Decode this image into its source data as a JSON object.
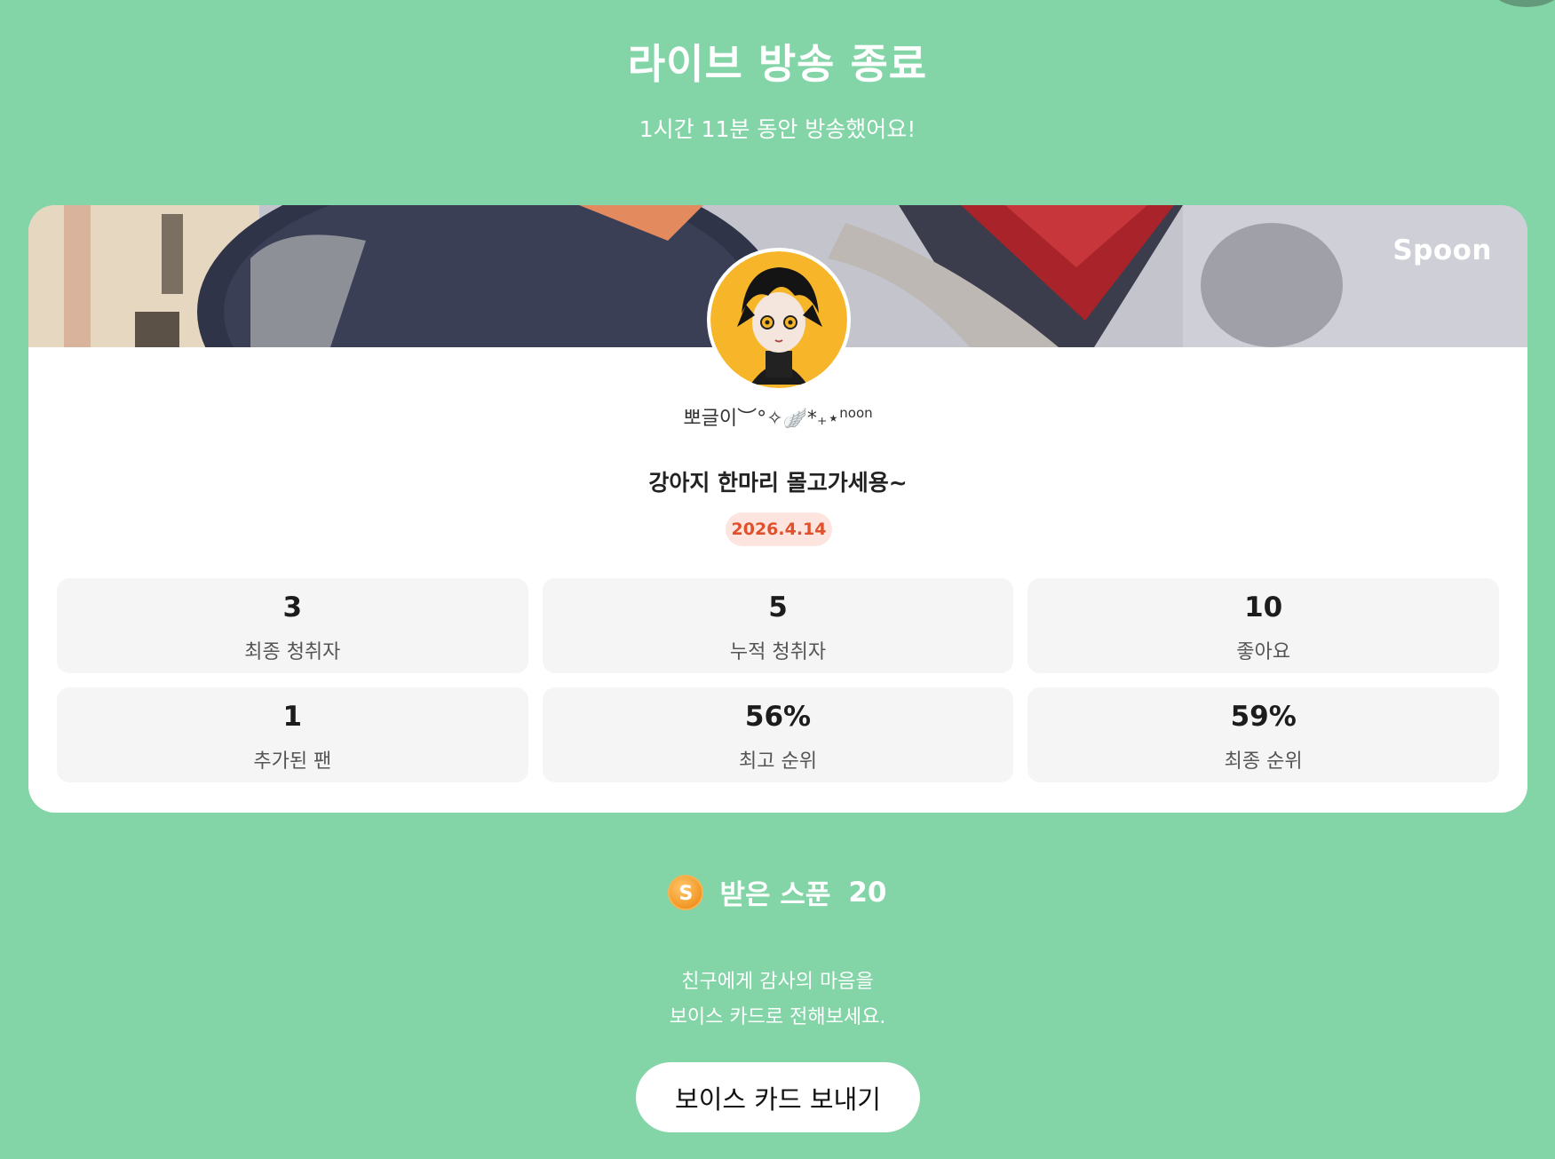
{
  "header": {
    "title": "라이브 방송 종료",
    "subtitle": "1시간 11분 동안 방송했어요!"
  },
  "card": {
    "brand": "Spoon",
    "nickname": "뽀글이︶°✧🪽*₊⋆",
    "nickname_suffix": "noon",
    "live_title": "강아지 한마리 몰고가세용~",
    "date": "2026.4.14",
    "stats": [
      {
        "value": "3",
        "label": "최종 청취자"
      },
      {
        "value": "5",
        "label": "누적 청취자"
      },
      {
        "value": "10",
        "label": "좋아요"
      },
      {
        "value": "1",
        "label": "추가된 팬"
      },
      {
        "value": "56%",
        "label": "최고 순위"
      },
      {
        "value": "59%",
        "label": "최종 순위"
      }
    ]
  },
  "spoons": {
    "coin_symbol": "S",
    "label": "받은 스푼",
    "count": "20"
  },
  "thanks": {
    "line1": "친구에게 감사의 마음을",
    "line2": "보이스 카드로 전해보세요."
  },
  "actions": {
    "voice_card_label": "보이스 카드 보내기"
  },
  "colors": {
    "background": "#83d5a7",
    "date_badge_text": "#e0502b",
    "date_badge_bg": "#fde4df"
  }
}
